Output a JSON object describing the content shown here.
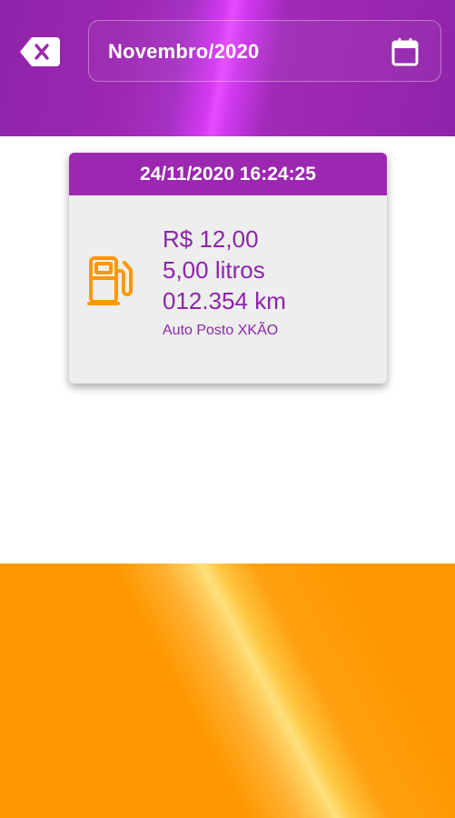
{
  "header": {
    "back_icon": "backspace-icon",
    "month_label": "Novembro/2020",
    "calendar_icon": "calendar-icon"
  },
  "records": [
    {
      "datetime": "24/11/2020 16:24:25",
      "amount": "R$ 12,00",
      "volume": "5,00 litros",
      "odometer": "012.354 km",
      "station": "Auto Posto XKÃO",
      "icon": "fuel-pump-icon"
    }
  ],
  "colors": {
    "primary": "#9c27b0",
    "accent": "#ff9800",
    "card_background": "#eeeeee",
    "text_purple": "#8e24aa"
  }
}
